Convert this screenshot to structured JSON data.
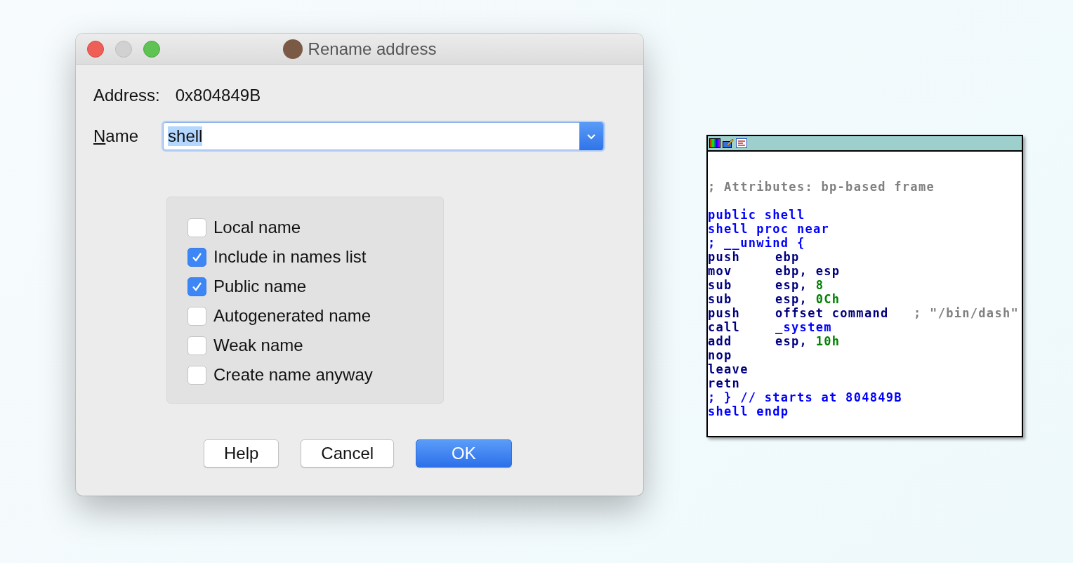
{
  "dialog": {
    "title": "Rename address",
    "address_label": "Address:",
    "address_value": "0x804849B",
    "name_label": "Name",
    "name_value": "shell",
    "options": [
      {
        "label": "Local name",
        "checked": false
      },
      {
        "label": "Include in names list",
        "checked": true
      },
      {
        "label": "Public name",
        "checked": true
      },
      {
        "label": "Autogenerated name",
        "checked": false
      },
      {
        "label": "Weak name",
        "checked": false
      },
      {
        "label": "Create name anyway",
        "checked": false
      }
    ],
    "buttons": [
      {
        "label": "Help",
        "default": false
      },
      {
        "label": "Cancel",
        "default": false
      },
      {
        "label": "OK",
        "default": true
      }
    ]
  },
  "disassembly": {
    "blocks": [
      [
        [
          {
            "text": "; Attributes: bp-based frame",
            "kind": "comment"
          }
        ]
      ],
      [
        [
          {
            "text": "public shell",
            "kind": "label"
          }
        ],
        [
          {
            "text": "shell proc near",
            "kind": "label"
          }
        ],
        [
          {
            "text": "; __unwind {",
            "kind": "label"
          }
        ],
        [
          {
            "text": "push",
            "kind": "mnemonic"
          },
          {
            "text": "ebp",
            "kind": "operand"
          }
        ],
        [
          {
            "text": "mov",
            "kind": "mnemonic"
          },
          {
            "text": "ebp, esp",
            "kind": "operand"
          }
        ],
        [
          {
            "text": "sub",
            "kind": "mnemonic"
          },
          {
            "text": "esp,",
            "kind": "operand"
          },
          {
            "text": "8",
            "kind": "number"
          }
        ],
        [
          {
            "text": "sub",
            "kind": "mnemonic"
          },
          {
            "text": "esp,",
            "kind": "operand"
          },
          {
            "text": "0Ch",
            "kind": "number"
          }
        ],
        [
          {
            "text": "push",
            "kind": "mnemonic"
          },
          {
            "text": "offset command",
            "kind": "operand"
          },
          {
            "text": "; \"/bin/dash\"",
            "kind": "comment"
          }
        ],
        [
          {
            "text": "call",
            "kind": "mnemonic"
          },
          {
            "text": "_system",
            "kind": "label"
          }
        ],
        [
          {
            "text": "add",
            "kind": "mnemonic"
          },
          {
            "text": "esp,",
            "kind": "operand"
          },
          {
            "text": "10h",
            "kind": "number"
          }
        ],
        [
          {
            "text": "nop",
            "kind": "mnemonic"
          }
        ],
        [
          {
            "text": "leave",
            "kind": "mnemonic"
          }
        ],
        [
          {
            "text": "retn",
            "kind": "mnemonic"
          }
        ],
        [
          {
            "text": "; } // starts at 804849B",
            "kind": "label"
          }
        ],
        [
          {
            "text": "shell endp",
            "kind": "label"
          }
        ]
      ]
    ]
  }
}
